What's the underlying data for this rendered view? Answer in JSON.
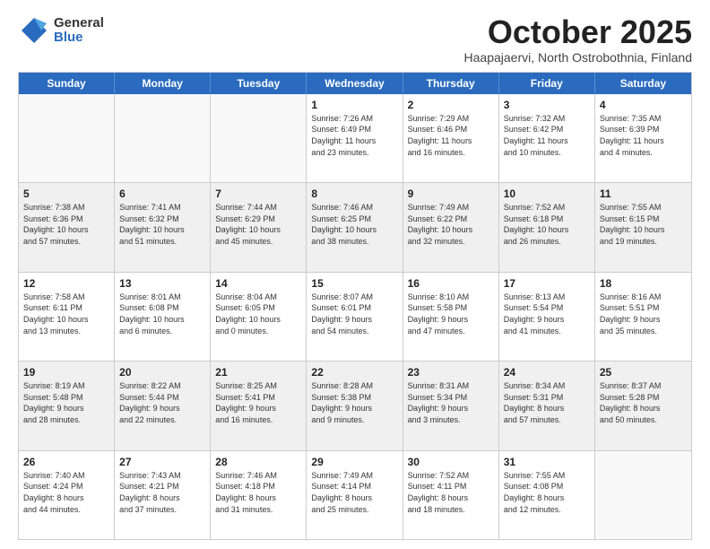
{
  "logo": {
    "general": "General",
    "blue": "Blue"
  },
  "header": {
    "month": "October 2025",
    "location": "Haapajaervi, North Ostrobothnia, Finland"
  },
  "weekdays": [
    "Sunday",
    "Monday",
    "Tuesday",
    "Wednesday",
    "Thursday",
    "Friday",
    "Saturday"
  ],
  "rows": [
    [
      {
        "day": "",
        "text": "",
        "empty": true
      },
      {
        "day": "",
        "text": "",
        "empty": true
      },
      {
        "day": "",
        "text": "",
        "empty": true
      },
      {
        "day": "1",
        "text": "Sunrise: 7:26 AM\nSunset: 6:49 PM\nDaylight: 11 hours\nand 23 minutes."
      },
      {
        "day": "2",
        "text": "Sunrise: 7:29 AM\nSunset: 6:46 PM\nDaylight: 11 hours\nand 16 minutes."
      },
      {
        "day": "3",
        "text": "Sunrise: 7:32 AM\nSunset: 6:42 PM\nDaylight: 11 hours\nand 10 minutes."
      },
      {
        "day": "4",
        "text": "Sunrise: 7:35 AM\nSunset: 6:39 PM\nDaylight: 11 hours\nand 4 minutes."
      }
    ],
    [
      {
        "day": "5",
        "text": "Sunrise: 7:38 AM\nSunset: 6:36 PM\nDaylight: 10 hours\nand 57 minutes.",
        "shaded": true
      },
      {
        "day": "6",
        "text": "Sunrise: 7:41 AM\nSunset: 6:32 PM\nDaylight: 10 hours\nand 51 minutes.",
        "shaded": true
      },
      {
        "day": "7",
        "text": "Sunrise: 7:44 AM\nSunset: 6:29 PM\nDaylight: 10 hours\nand 45 minutes.",
        "shaded": true
      },
      {
        "day": "8",
        "text": "Sunrise: 7:46 AM\nSunset: 6:25 PM\nDaylight: 10 hours\nand 38 minutes.",
        "shaded": true
      },
      {
        "day": "9",
        "text": "Sunrise: 7:49 AM\nSunset: 6:22 PM\nDaylight: 10 hours\nand 32 minutes.",
        "shaded": true
      },
      {
        "day": "10",
        "text": "Sunrise: 7:52 AM\nSunset: 6:18 PM\nDaylight: 10 hours\nand 26 minutes.",
        "shaded": true
      },
      {
        "day": "11",
        "text": "Sunrise: 7:55 AM\nSunset: 6:15 PM\nDaylight: 10 hours\nand 19 minutes.",
        "shaded": true
      }
    ],
    [
      {
        "day": "12",
        "text": "Sunrise: 7:58 AM\nSunset: 6:11 PM\nDaylight: 10 hours\nand 13 minutes."
      },
      {
        "day": "13",
        "text": "Sunrise: 8:01 AM\nSunset: 6:08 PM\nDaylight: 10 hours\nand 6 minutes."
      },
      {
        "day": "14",
        "text": "Sunrise: 8:04 AM\nSunset: 6:05 PM\nDaylight: 10 hours\nand 0 minutes."
      },
      {
        "day": "15",
        "text": "Sunrise: 8:07 AM\nSunset: 6:01 PM\nDaylight: 9 hours\nand 54 minutes."
      },
      {
        "day": "16",
        "text": "Sunrise: 8:10 AM\nSunset: 5:58 PM\nDaylight: 9 hours\nand 47 minutes."
      },
      {
        "day": "17",
        "text": "Sunrise: 8:13 AM\nSunset: 5:54 PM\nDaylight: 9 hours\nand 41 minutes."
      },
      {
        "day": "18",
        "text": "Sunrise: 8:16 AM\nSunset: 5:51 PM\nDaylight: 9 hours\nand 35 minutes."
      }
    ],
    [
      {
        "day": "19",
        "text": "Sunrise: 8:19 AM\nSunset: 5:48 PM\nDaylight: 9 hours\nand 28 minutes.",
        "shaded": true
      },
      {
        "day": "20",
        "text": "Sunrise: 8:22 AM\nSunset: 5:44 PM\nDaylight: 9 hours\nand 22 minutes.",
        "shaded": true
      },
      {
        "day": "21",
        "text": "Sunrise: 8:25 AM\nSunset: 5:41 PM\nDaylight: 9 hours\nand 16 minutes.",
        "shaded": true
      },
      {
        "day": "22",
        "text": "Sunrise: 8:28 AM\nSunset: 5:38 PM\nDaylight: 9 hours\nand 9 minutes.",
        "shaded": true
      },
      {
        "day": "23",
        "text": "Sunrise: 8:31 AM\nSunset: 5:34 PM\nDaylight: 9 hours\nand 3 minutes.",
        "shaded": true
      },
      {
        "day": "24",
        "text": "Sunrise: 8:34 AM\nSunset: 5:31 PM\nDaylight: 8 hours\nand 57 minutes.",
        "shaded": true
      },
      {
        "day": "25",
        "text": "Sunrise: 8:37 AM\nSunset: 5:28 PM\nDaylight: 8 hours\nand 50 minutes.",
        "shaded": true
      }
    ],
    [
      {
        "day": "26",
        "text": "Sunrise: 7:40 AM\nSunset: 4:24 PM\nDaylight: 8 hours\nand 44 minutes."
      },
      {
        "day": "27",
        "text": "Sunrise: 7:43 AM\nSunset: 4:21 PM\nDaylight: 8 hours\nand 37 minutes."
      },
      {
        "day": "28",
        "text": "Sunrise: 7:46 AM\nSunset: 4:18 PM\nDaylight: 8 hours\nand 31 minutes."
      },
      {
        "day": "29",
        "text": "Sunrise: 7:49 AM\nSunset: 4:14 PM\nDaylight: 8 hours\nand 25 minutes."
      },
      {
        "day": "30",
        "text": "Sunrise: 7:52 AM\nSunset: 4:11 PM\nDaylight: 8 hours\nand 18 minutes."
      },
      {
        "day": "31",
        "text": "Sunrise: 7:55 AM\nSunset: 4:08 PM\nDaylight: 8 hours\nand 12 minutes."
      },
      {
        "day": "",
        "text": "",
        "empty": true
      }
    ]
  ]
}
